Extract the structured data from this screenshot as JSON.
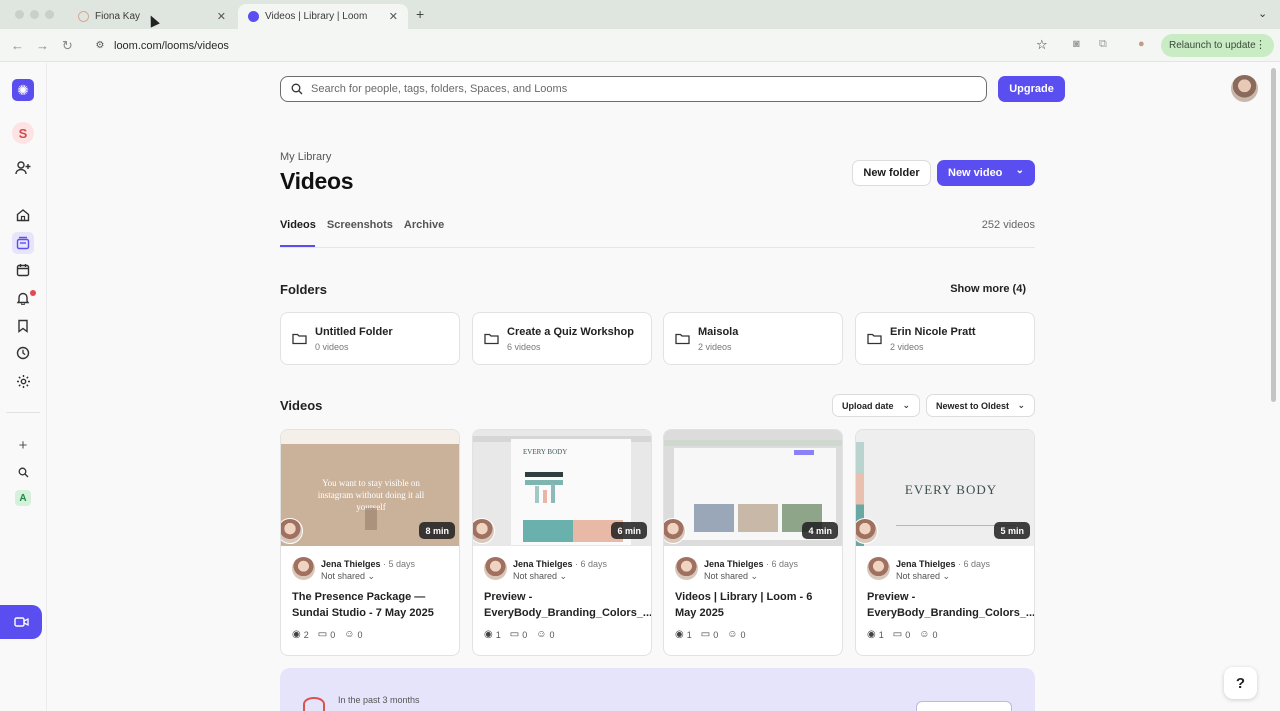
{
  "browser": {
    "tabs": [
      {
        "label": "Fiona Kay",
        "active": false
      },
      {
        "label": "Videos | Library | Loom",
        "active": true
      }
    ],
    "new_tab": "+",
    "tab_close": "✕",
    "url": "loom.com/looms/videos",
    "relaunch_label": "Relaunch to update"
  },
  "rail": {
    "workspace_initial": "S",
    "bottom_workspace_initial": "A",
    "icons": [
      "loom-logo-icon",
      "add-user-icon",
      "home-icon",
      "library-icon",
      "calendar-icon",
      "bell-icon",
      "bookmark-icon",
      "clock-icon",
      "settings-icon",
      "plus-icon",
      "search-icon",
      "record-icon"
    ]
  },
  "search": {
    "placeholder": "Search for people, tags, folders, Spaces, and Looms"
  },
  "upgrade_label": "Upgrade",
  "header": {
    "breadcrumb": "My Library",
    "title": "Videos",
    "new_folder_label": "New folder",
    "new_video_label": "New video"
  },
  "tabs": [
    {
      "label": "Videos",
      "active": true
    },
    {
      "label": "Screenshots",
      "active": false
    },
    {
      "label": "Archive",
      "active": false
    }
  ],
  "video_count": "252 videos",
  "folders_section": {
    "heading": "Folders",
    "show_more": "Show more (4)",
    "items": [
      {
        "name": "Untitled Folder",
        "count": "0 videos"
      },
      {
        "name": "Create a Quiz Workshop",
        "count": "6 videos"
      },
      {
        "name": "Maisola",
        "count": "2 videos"
      },
      {
        "name": "Erin Nicole Pratt",
        "count": "2 videos"
      }
    ]
  },
  "videos_section": {
    "heading": "Videos",
    "sort_field": "Upload date",
    "sort_order": "Newest to Oldest",
    "items": [
      {
        "duration": "8 min",
        "author": "Jena Thielges",
        "ago": "· 5 days",
        "sharing": "Not shared",
        "title": "The Presence Package — Sundai Studio - 7 May 2025",
        "views": "2",
        "comments": "0",
        "reactions": "0",
        "thumb_text": "You want to stay visible on instagram without doing it all yourself"
      },
      {
        "duration": "6 min",
        "author": "Jena Thielges",
        "ago": "· 6 days",
        "sharing": "Not shared",
        "title": "Preview - EveryBody_Branding_Colors_...",
        "views": "1",
        "comments": "0",
        "reactions": "0",
        "thumb_text": "EVERY BODY"
      },
      {
        "duration": "4 min",
        "author": "Jena Thielges",
        "ago": "· 6 days",
        "sharing": "Not shared",
        "title": "Videos | Library | Loom - 6 May 2025",
        "views": "1",
        "comments": "0",
        "reactions": "0",
        "thumb_text": ""
      },
      {
        "duration": "5 min",
        "author": "Jena Thielges",
        "ago": "· 6 days",
        "sharing": "Not shared",
        "title": "Preview - EveryBody_Branding_Colors_...",
        "views": "1",
        "comments": "0",
        "reactions": "0",
        "thumb_text": "EVERY BODY"
      }
    ]
  },
  "banner": {
    "period": "In the past 3 months"
  },
  "help_label": "?",
  "colors": {
    "accent": "#5b4ef0",
    "notification": "#e5484d",
    "relaunch_bg": "#c9ecc5"
  }
}
